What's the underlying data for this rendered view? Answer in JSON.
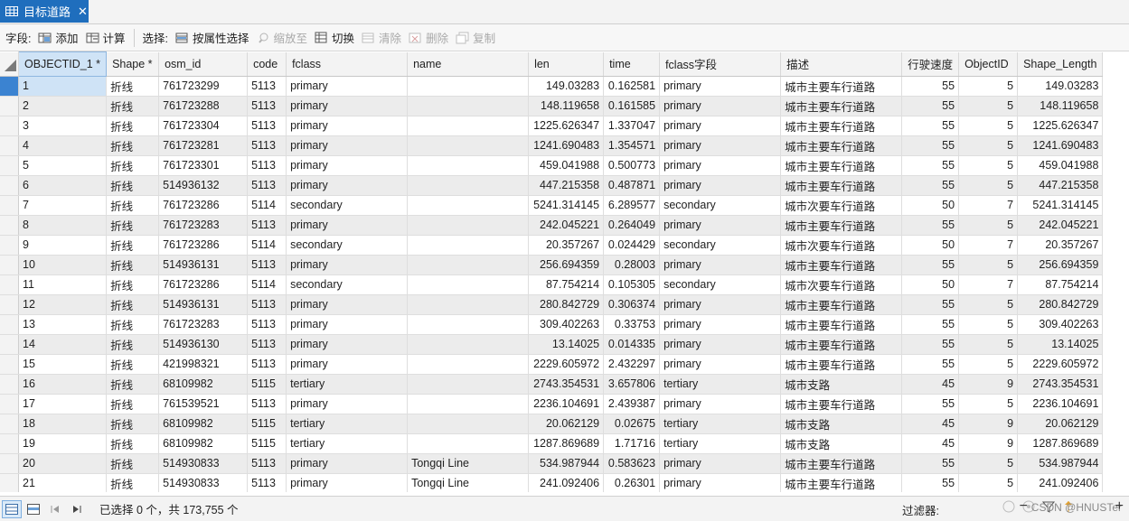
{
  "tab": {
    "title": "目标道路",
    "close": "✕"
  },
  "toolbar": {
    "field_label": "字段:",
    "add": "添加",
    "calc": "计算",
    "select_label": "选择:",
    "select_by_attr": "按属性选择",
    "zoom_to": "缩放至",
    "switch": "切换",
    "clear": "清除",
    "delete": "删除",
    "copy": "复制"
  },
  "columns": [
    {
      "label": "OBJECTID_1 *",
      "width": 93
    },
    {
      "label": "Shape *",
      "width": 58
    },
    {
      "label": "osm_id",
      "width": 98
    },
    {
      "label": "code",
      "width": 43
    },
    {
      "label": "fclass",
      "width": 134
    },
    {
      "label": "name",
      "width": 134
    },
    {
      "label": "len",
      "width": 83
    },
    {
      "label": "time",
      "width": 62
    },
    {
      "label": "fclass字段",
      "width": 134
    },
    {
      "label": "描述",
      "width": 134
    },
    {
      "label": "行驶速度",
      "width": 62
    },
    {
      "label": "ObjectID",
      "width": 65
    },
    {
      "label": "Shape_Length",
      "width": 92
    }
  ],
  "rows": [
    [
      "1",
      "折线",
      "761723299",
      "5113",
      "primary",
      "",
      "149.03283",
      "0.162581",
      "primary",
      "城市主要车行道路",
      "55",
      "5",
      "149.03283"
    ],
    [
      "2",
      "折线",
      "761723288",
      "5113",
      "primary",
      "",
      "148.119658",
      "0.161585",
      "primary",
      "城市主要车行道路",
      "55",
      "5",
      "148.119658"
    ],
    [
      "3",
      "折线",
      "761723304",
      "5113",
      "primary",
      "",
      "1225.626347",
      "1.337047",
      "primary",
      "城市主要车行道路",
      "55",
      "5",
      "1225.626347"
    ],
    [
      "4",
      "折线",
      "761723281",
      "5113",
      "primary",
      "",
      "1241.690483",
      "1.354571",
      "primary",
      "城市主要车行道路",
      "55",
      "5",
      "1241.690483"
    ],
    [
      "5",
      "折线",
      "761723301",
      "5113",
      "primary",
      "",
      "459.041988",
      "0.500773",
      "primary",
      "城市主要车行道路",
      "55",
      "5",
      "459.041988"
    ],
    [
      "6",
      "折线",
      "514936132",
      "5113",
      "primary",
      "",
      "447.215358",
      "0.487871",
      "primary",
      "城市主要车行道路",
      "55",
      "5",
      "447.215358"
    ],
    [
      "7",
      "折线",
      "761723286",
      "5114",
      "secondary",
      "",
      "5241.314145",
      "6.289577",
      "secondary",
      "城市次要车行道路",
      "50",
      "7",
      "5241.314145"
    ],
    [
      "8",
      "折线",
      "761723283",
      "5113",
      "primary",
      "",
      "242.045221",
      "0.264049",
      "primary",
      "城市主要车行道路",
      "55",
      "5",
      "242.045221"
    ],
    [
      "9",
      "折线",
      "761723286",
      "5114",
      "secondary",
      "",
      "20.357267",
      "0.024429",
      "secondary",
      "城市次要车行道路",
      "50",
      "7",
      "20.357267"
    ],
    [
      "10",
      "折线",
      "514936131",
      "5113",
      "primary",
      "",
      "256.694359",
      "0.28003",
      "primary",
      "城市主要车行道路",
      "55",
      "5",
      "256.694359"
    ],
    [
      "11",
      "折线",
      "761723286",
      "5114",
      "secondary",
      "",
      "87.754214",
      "0.105305",
      "secondary",
      "城市次要车行道路",
      "50",
      "7",
      "87.754214"
    ],
    [
      "12",
      "折线",
      "514936131",
      "5113",
      "primary",
      "",
      "280.842729",
      "0.306374",
      "primary",
      "城市主要车行道路",
      "55",
      "5",
      "280.842729"
    ],
    [
      "13",
      "折线",
      "761723283",
      "5113",
      "primary",
      "",
      "309.402263",
      "0.33753",
      "primary",
      "城市主要车行道路",
      "55",
      "5",
      "309.402263"
    ],
    [
      "14",
      "折线",
      "514936130",
      "5113",
      "primary",
      "",
      "13.14025",
      "0.014335",
      "primary",
      "城市主要车行道路",
      "55",
      "5",
      "13.14025"
    ],
    [
      "15",
      "折线",
      "421998321",
      "5113",
      "primary",
      "",
      "2229.605972",
      "2.432297",
      "primary",
      "城市主要车行道路",
      "55",
      "5",
      "2229.605972"
    ],
    [
      "16",
      "折线",
      "68109982",
      "5115",
      "tertiary",
      "",
      "2743.354531",
      "3.657806",
      "tertiary",
      "城市支路",
      "45",
      "9",
      "2743.354531"
    ],
    [
      "17",
      "折线",
      "761539521",
      "5113",
      "primary",
      "",
      "2236.104691",
      "2.439387",
      "primary",
      "城市主要车行道路",
      "55",
      "5",
      "2236.104691"
    ],
    [
      "18",
      "折线",
      "68109982",
      "5115",
      "tertiary",
      "",
      "20.062129",
      "0.02675",
      "tertiary",
      "城市支路",
      "45",
      "9",
      "20.062129"
    ],
    [
      "19",
      "折线",
      "68109982",
      "5115",
      "tertiary",
      "",
      "1287.869689",
      "1.71716",
      "tertiary",
      "城市支路",
      "45",
      "9",
      "1287.869689"
    ],
    [
      "20",
      "折线",
      "514930833",
      "5113",
      "primary",
      "Tongqi Line",
      "534.987944",
      "0.583623",
      "primary",
      "城市主要车行道路",
      "55",
      "5",
      "534.987944"
    ],
    [
      "21",
      "折线",
      "514930833",
      "5113",
      "primary",
      "Tongqi Line",
      "241.092406",
      "0.26301",
      "primary",
      "城市主要车行道路",
      "55",
      "5",
      "241.092406"
    ]
  ],
  "status": {
    "selection": "已选择 0 个，共 173,755 个",
    "filter_label": "过滤器:",
    "watermark": "CSDN @HNUSTer",
    "zoom_minus": "−",
    "zoom_plus": "+"
  },
  "colors": {
    "tab_bg": "#1f6ebd",
    "selected_header": "#cfe3f6",
    "alt_row": "#ececec"
  }
}
